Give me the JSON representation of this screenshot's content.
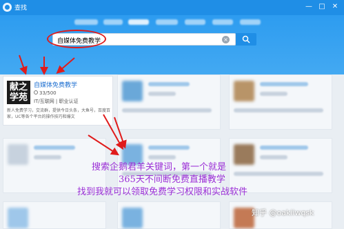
{
  "window": {
    "title": "查找",
    "controls": [
      "minimize-icon",
      "maximize-icon",
      "close-icon"
    ]
  },
  "search": {
    "query": "自媒体免费教学",
    "clear_icon": "close-icon",
    "button_icon": "search-icon"
  },
  "result_card": {
    "name": "自媒体免费教学",
    "avatar_text": "献之学苑",
    "members": "33/500",
    "tags": "IT/互联网 | 职业认证",
    "description": "新人免费学习，交流群，提供今日头条，大鱼号，百度百家，UC等各个平台的操作技巧和爆文"
  },
  "overlay": {
    "line1": "搜索企鹅君羊关键词，第一个就是",
    "line2": "365天不间断免费直播教学",
    "line3": "找到我就可以领取免费学习权限和实战软件"
  },
  "watermark": "知乎 @oakiiwqsk",
  "colors": {
    "header": "#2d9cf0",
    "highlight": "#e01b1b",
    "overlay_text": "#9b2fd6",
    "link": "#1e6fd0"
  }
}
